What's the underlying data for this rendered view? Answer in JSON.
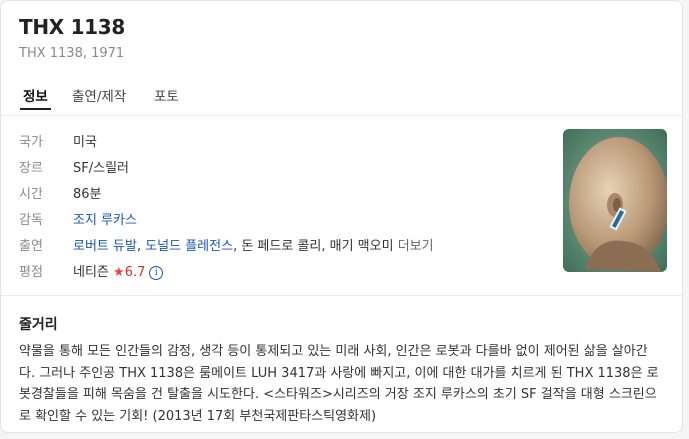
{
  "title": "THX 1138",
  "subtitle": "THX 1138, 1971",
  "tabs": [
    {
      "label": "정보",
      "active": true
    },
    {
      "label": "출연/제작",
      "active": false
    },
    {
      "label": "포토",
      "active": false
    }
  ],
  "info": {
    "country": {
      "label": "국가",
      "value": "미국"
    },
    "genre": {
      "label": "장르",
      "value": "SF/스릴러"
    },
    "runtime": {
      "label": "시간",
      "value": "86분"
    },
    "director": {
      "label": "감독",
      "value": "조지 루카스"
    },
    "cast": {
      "label": "출연",
      "names": [
        "로버트 듀발",
        "도널드 플레전스",
        "돈 페드로 콜리",
        "매기 맥오미"
      ],
      "more": "더보기"
    },
    "rating": {
      "label": "평점",
      "source": "네티즌",
      "star": "★",
      "score": "6.7",
      "info_icon": "info-icon"
    }
  },
  "poster": {
    "icon": "movie-poster-image"
  },
  "synopsis": {
    "heading": "줄거리",
    "text": "약물을 통해 모든 인간들의 감정, 생각 등이 통제되고 있는 미래 사회, 인간은 로봇과 다를바 없이 제어된 삶을 살아간다. 그러나 주인공 THX 1138은 룸메이트 LUH 3417과 사랑에 빠지고, 이에 대한 대가를 치르게 된 THX 1138은 로봇경찰들을 피해 목숨을 건 탈출을 시도한다. <스타워즈>시리즈의 거장 조지 루카스의 초기 SF 걸작을 대형 스크린으로 확인할 수 있는 기회! (2013년 17회 부천국제판타스틱영화제)"
  },
  "colors": {
    "link": "#1a56b3",
    "star": "#e8453c",
    "label": "#8a8a8a"
  }
}
